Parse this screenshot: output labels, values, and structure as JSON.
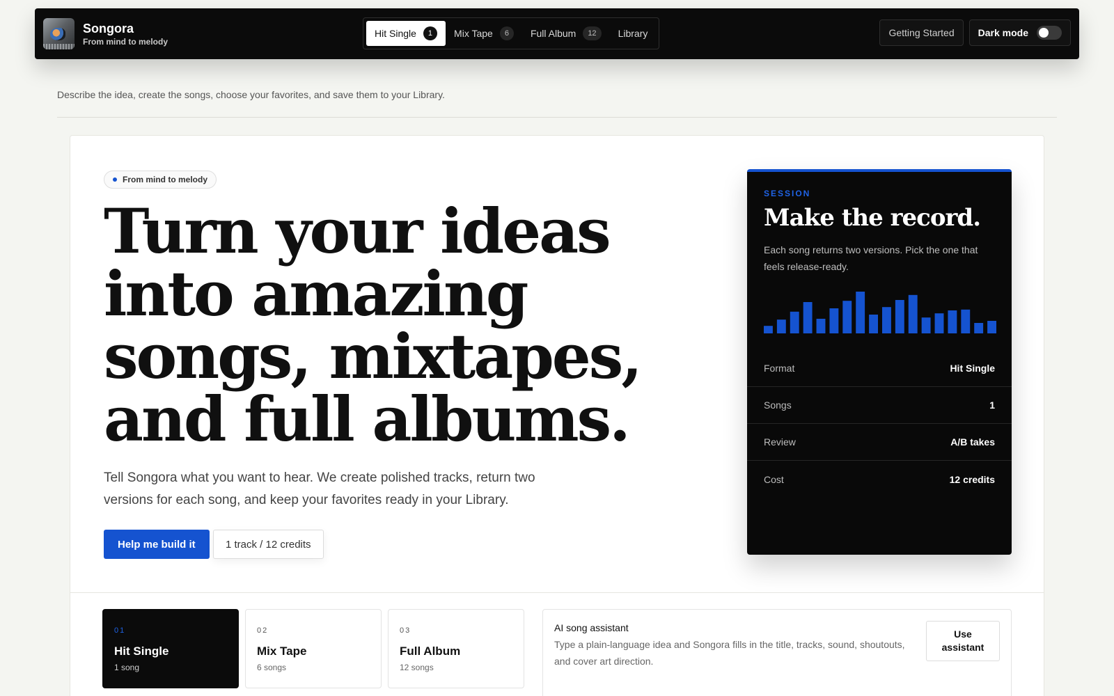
{
  "brand": {
    "name": "Songora",
    "tagline": "From mind to melody"
  },
  "nav": {
    "tabs": [
      {
        "label": "Hit Single",
        "count": "1",
        "active": true
      },
      {
        "label": "Mix Tape",
        "count": "6"
      },
      {
        "label": "Full Album",
        "count": "12"
      },
      {
        "label": "Library"
      }
    ],
    "getting_started": "Getting Started",
    "dark_mode": "Dark mode"
  },
  "intro": "Describe the idea, create the songs, choose your favorites, and save them to your Library.",
  "hero": {
    "pill": "From mind to melody",
    "headline": "Turn your ideas into amazing songs, mixtapes, and full albums.",
    "subtext": "Tell Songora what you want to hear. We create polished tracks, return two versions for each song, and keep your favorites ready in your Library.",
    "cta_primary": "Help me build it",
    "cta_secondary": "1 track / 12 credits"
  },
  "session": {
    "eyebrow": "SESSION",
    "title": "Make the record.",
    "description": "Each song returns two versions. Pick the one that feels release-ready.",
    "waveform": [
      0.18,
      0.33,
      0.52,
      0.75,
      0.35,
      0.6,
      0.78,
      1.0,
      0.45,
      0.63,
      0.8,
      0.92,
      0.38,
      0.48,
      0.55,
      0.57,
      0.25,
      0.3
    ],
    "accent": "#1553d0",
    "rows": [
      {
        "key": "Format",
        "value": "Hit Single"
      },
      {
        "key": "Songs",
        "value": "1"
      },
      {
        "key": "Review",
        "value": "A/B takes"
      },
      {
        "key": "Cost",
        "value": "12 credits"
      }
    ]
  },
  "formats": [
    {
      "num": "01",
      "name": "Hit Single",
      "meta": "1 song",
      "active": true
    },
    {
      "num": "02",
      "name": "Mix Tape",
      "meta": "6 songs"
    },
    {
      "num": "03",
      "name": "Full Album",
      "meta": "12 songs"
    }
  ],
  "assistant": {
    "title": "AI song assistant",
    "description": "Type a plain-language idea and Songora fills in the title, tracks, sound, shoutouts, and cover art direction.",
    "button": "Use assistant"
  }
}
